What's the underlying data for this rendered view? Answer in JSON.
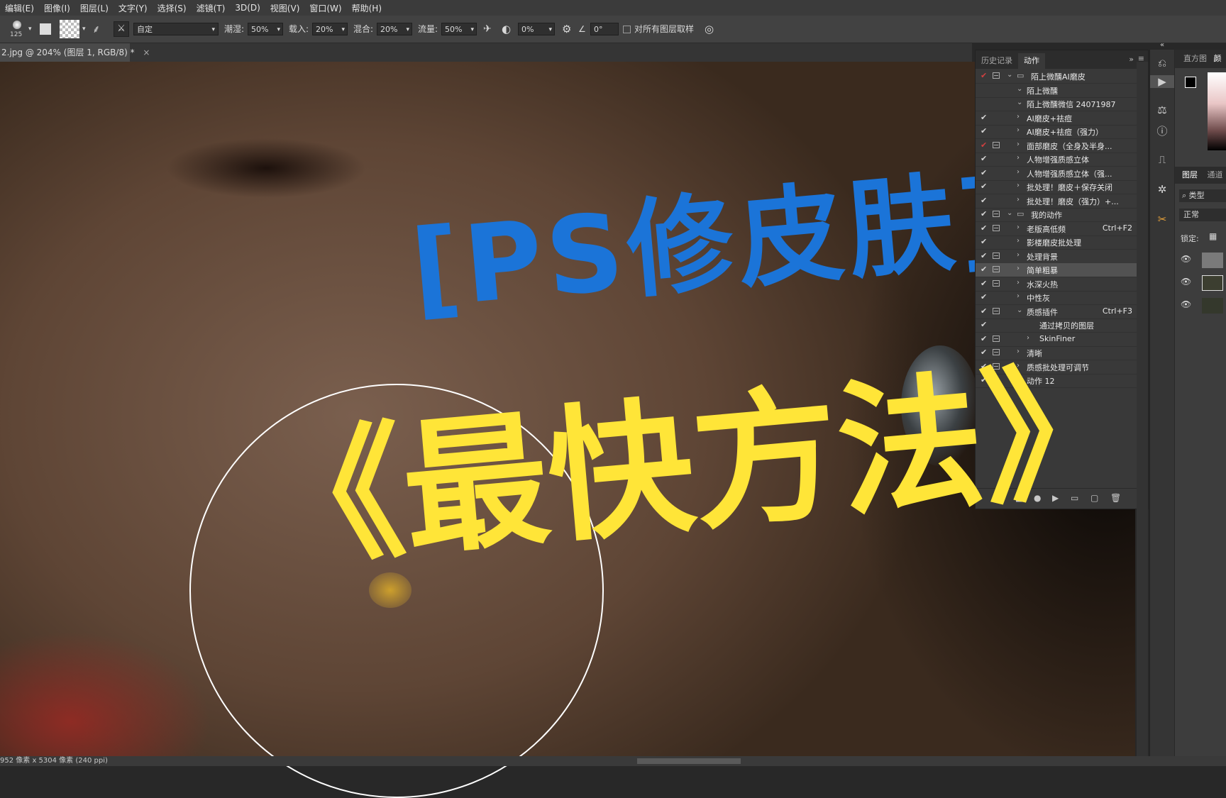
{
  "menu": [
    "编辑(E)",
    "图像(I)",
    "图层(L)",
    "文字(Y)",
    "选择(S)",
    "滤镜(T)",
    "3D(D)",
    "视图(V)",
    "窗口(W)",
    "帮助(H)"
  ],
  "options": {
    "brush_size": "125",
    "mode_value": "自定",
    "wet_label": "潮湿:",
    "wet_value": "50%",
    "load_label": "载入:",
    "load_value": "20%",
    "mix_label": "混合:",
    "mix_value": "20%",
    "flow_label": "流量:",
    "flow_value": "50%",
    "smooth_value": "0%",
    "angle_value": "0°",
    "sample_all_label": "对所有图层取样"
  },
  "document_tab": {
    "title": "2.jpg @ 204% (图层 1, RGB/8) *",
    "close": "×"
  },
  "status_text": "952 像素 x 5304 像素 (240 ppi)",
  "overlay": {
    "title": "[PS修皮肤]",
    "subtitle": "《最快方法》"
  },
  "panel": {
    "tabs": [
      "历史记录",
      "动作"
    ],
    "active_tab": "动作",
    "rows": [
      {
        "label": "陌上微醺AI磨皮",
        "check": "red",
        "dialog": true,
        "arrow": "v",
        "indent": 1,
        "folder": true,
        "shortcut": ""
      },
      {
        "label": "陌上微醺",
        "check": "",
        "dialog": false,
        "arrow": "v",
        "indent": 2,
        "folder": false,
        "shortcut": ""
      },
      {
        "label": "陌上微醺微信 24071987",
        "check": "",
        "dialog": false,
        "arrow": "v",
        "indent": 2,
        "folder": false,
        "shortcut": ""
      },
      {
        "label": "AI磨皮+祛痘",
        "check": "on",
        "dialog": false,
        "arrow": ">",
        "indent": 2,
        "folder": false,
        "shortcut": ""
      },
      {
        "label": "AI磨皮+祛痘（强力）",
        "check": "on",
        "dialog": false,
        "arrow": ">",
        "indent": 2,
        "folder": false,
        "shortcut": ""
      },
      {
        "label": "面部磨皮（全身及半身...",
        "check": "red",
        "dialog": true,
        "arrow": ">",
        "indent": 2,
        "folder": false,
        "shortcut": ""
      },
      {
        "label": "人物增强质感立体",
        "check": "on",
        "dialog": false,
        "arrow": ">",
        "indent": 2,
        "folder": false,
        "shortcut": ""
      },
      {
        "label": "人物增强质感立体（强...",
        "check": "on",
        "dialog": false,
        "arrow": ">",
        "indent": 2,
        "folder": false,
        "shortcut": ""
      },
      {
        "label": "批处理！磨皮＋保存关闭",
        "check": "on",
        "dialog": false,
        "arrow": ">",
        "indent": 2,
        "folder": false,
        "shortcut": ""
      },
      {
        "label": "批处理！磨皮（强力）+...",
        "check": "on",
        "dialog": false,
        "arrow": ">",
        "indent": 2,
        "folder": false,
        "shortcut": ""
      },
      {
        "label": "我的动作",
        "check": "on",
        "dialog": true,
        "arrow": "v",
        "indent": 1,
        "folder": true,
        "shortcut": ""
      },
      {
        "label": "老版高低频",
        "check": "on",
        "dialog": true,
        "arrow": ">",
        "indent": 2,
        "folder": false,
        "shortcut": "Ctrl+F2"
      },
      {
        "label": "影楼磨皮批处理",
        "check": "on",
        "dialog": false,
        "arrow": ">",
        "indent": 2,
        "folder": false,
        "shortcut": ""
      },
      {
        "label": "处理背景",
        "check": "on",
        "dialog": true,
        "arrow": ">",
        "indent": 2,
        "folder": false,
        "shortcut": ""
      },
      {
        "label": "简单粗暴",
        "check": "on",
        "dialog": true,
        "arrow": ">",
        "indent": 2,
        "folder": false,
        "shortcut": "",
        "selected": true
      },
      {
        "label": "水深火热",
        "check": "on",
        "dialog": true,
        "arrow": ">",
        "indent": 2,
        "folder": false,
        "shortcut": ""
      },
      {
        "label": "中性灰",
        "check": "on",
        "dialog": false,
        "arrow": ">",
        "indent": 2,
        "folder": false,
        "shortcut": ""
      },
      {
        "label": "质感插件",
        "check": "on",
        "dialog": true,
        "arrow": "v",
        "indent": 2,
        "folder": false,
        "shortcut": "Ctrl+F3"
      },
      {
        "label": "通过拷贝的图层",
        "check": "on",
        "dialog": false,
        "arrow": "",
        "indent": 3,
        "folder": false,
        "shortcut": ""
      },
      {
        "label": "SkinFiner",
        "check": "on",
        "dialog": true,
        "arrow": ">",
        "indent": 3,
        "folder": false,
        "shortcut": ""
      },
      {
        "label": "清晰",
        "check": "on",
        "dialog": true,
        "arrow": ">",
        "indent": 2,
        "folder": false,
        "shortcut": ""
      },
      {
        "label": "质感批处理可调节",
        "check": "on",
        "dialog": true,
        "arrow": ">",
        "indent": 2,
        "folder": false,
        "shortcut": ""
      },
      {
        "label": "动作 12",
        "check": "on",
        "dialog": false,
        "arrow": ">",
        "indent": 2,
        "folder": false,
        "shortcut": ""
      }
    ]
  },
  "right": {
    "tabs": [
      "直方图",
      "颜"
    ],
    "layers_tab": "图层",
    "channels_tab": "通道",
    "kind_label": "类型",
    "blend_mode": "正常",
    "lock_label": "锁定:"
  },
  "colors": {
    "overlay_blue": "#1b74d8",
    "overlay_yellow": "#ffe538",
    "panel_bg": "#393939",
    "check_red": "#d04040"
  }
}
